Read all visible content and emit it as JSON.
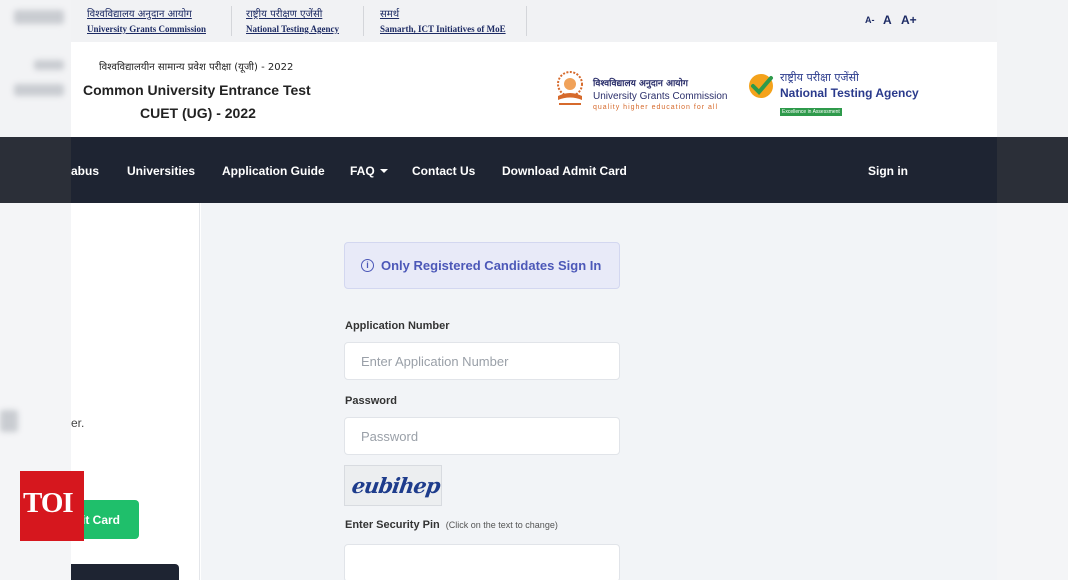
{
  "top_links": [
    {
      "hindi": "विश्वविद्यालय अनुदान आयोग",
      "english": "University Grants Commission"
    },
    {
      "hindi": "राष्ट्रीय परीक्षण एजेंसी",
      "english": "National Testing Agency"
    },
    {
      "hindi": "समर्थ",
      "english": "Samarth, ICT Initiatives of MoE"
    }
  ],
  "font_size_controls": [
    "A-",
    "A",
    "A+"
  ],
  "header": {
    "hindi_title": "विश्वविद्यालयीन सामान्य प्रवेश परीक्षा (यूजी) - 2022",
    "title_line1": "Common University Entrance Test",
    "title_line2": "CUET (UG) - 2022"
  },
  "logos": {
    "ugc": {
      "line1": "विश्वविद्यालय अनुदान आयोग",
      "line2": "University Grants Commission",
      "line3": "quality higher education for all",
      "icon": "ugc-emblem-icon"
    },
    "nta": {
      "line1": "राष्ट्रीय परीक्षा एजेंसी",
      "line2": "National Testing Agency",
      "line3": "Excellence in Assessment",
      "icon": "nta-check-icon"
    }
  },
  "nav": {
    "items": [
      "abus",
      "Universities",
      "Application Guide",
      "FAQ",
      "Contact Us",
      "Download Admit Card"
    ],
    "sign_in": "Sign in"
  },
  "left_pane": {
    "partial_text": "er.",
    "admit_button": "it Card"
  },
  "signin_form": {
    "alert": "Only Registered Candidates Sign In",
    "application_number_label": "Application Number",
    "application_number_placeholder": "Enter Application Number",
    "password_label": "Password",
    "password_placeholder": "Password",
    "captcha_text": "eubihep",
    "security_pin_label": "Enter Security Pin",
    "security_pin_hint": "(Click on the text to change)"
  },
  "watermark": "TOI",
  "colors": {
    "navbar": "#1e2432",
    "alert_text": "#4c58b8",
    "admit_button": "#1fbf6b",
    "watermark": "#d6171e"
  }
}
